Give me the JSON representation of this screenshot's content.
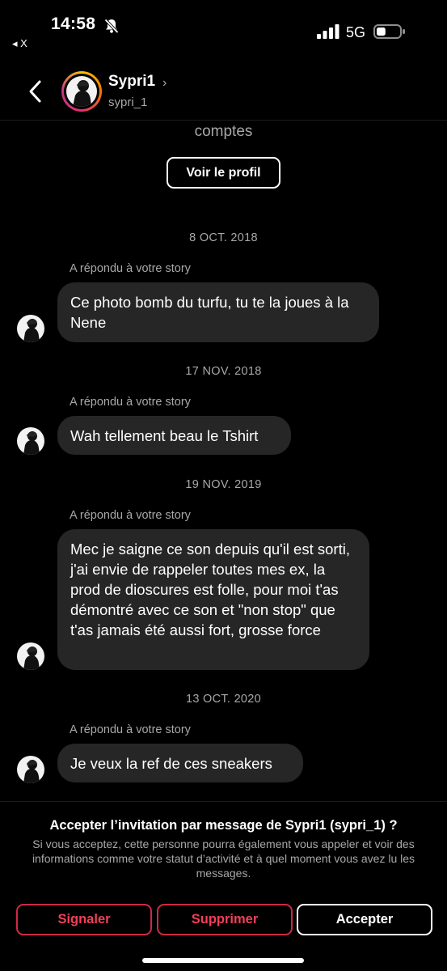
{
  "status_bar": {
    "time": "14:58",
    "back_app": "◂ X",
    "network": "5G",
    "battery_level": 0.4
  },
  "header": {
    "name": "Sypri1",
    "username": "sypri_1"
  },
  "thread": {
    "partial_text": "comptes",
    "view_profile_label": "Voir le profil",
    "items": [
      {
        "date": "8 OCT. 2018",
        "replied": "A répondu à votre story",
        "message": "Ce photo bomb du turfu, tu te la joues à la Nene"
      },
      {
        "date": "17 NOV. 2018",
        "replied": "A répondu à votre story",
        "message": "Wah tellement beau le Tshirt"
      },
      {
        "date": "19 NOV. 2019",
        "replied": "A répondu à votre story",
        "message": "Mec je saigne ce son depuis qu'il est sorti, j'ai envie de rappeler toutes mes ex, la prod de dioscures est folle, pour moi t'as démontré avec ce son et \"non stop\" que t'as jamais été aussi fort, grosse force"
      },
      {
        "date": "13 OCT. 2020",
        "replied": "A répondu à votre story",
        "message": "Je veux la ref de ces sneakers"
      }
    ]
  },
  "invite": {
    "title": "Accepter l’invitation par message de Sypri1 (sypri_1) ?",
    "text": "Si vous acceptez, cette personne pourra également vous appeler et voir des informations comme votre statut d’activité et à quel moment vous avez lu les messages."
  },
  "buttons": {
    "report": "Signaler",
    "delete": "Supprimer",
    "accept": "Accepter"
  },
  "colors": {
    "background": "#000000",
    "bubble": "#262626",
    "danger": "#f0405a",
    "muted": "#a8a8a8"
  }
}
